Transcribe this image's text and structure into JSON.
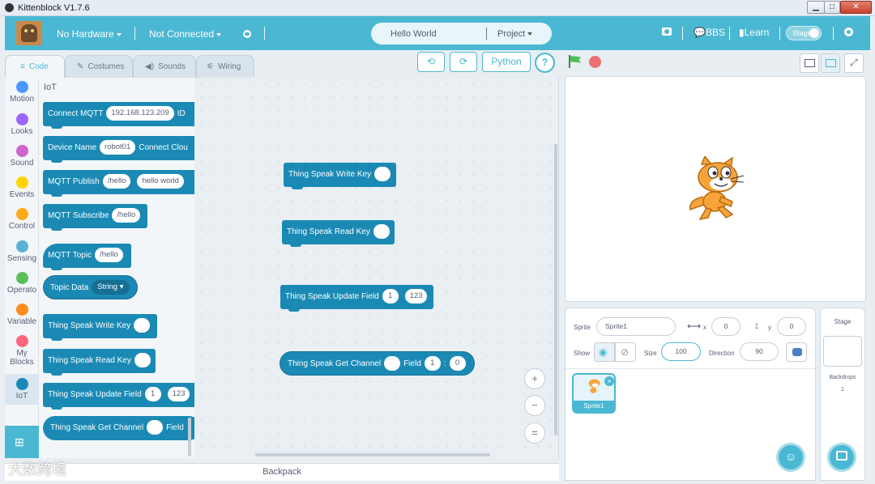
{
  "window": {
    "title": "Kittenblock V1.7.6",
    "controls": [
      "▁",
      "□",
      "✕"
    ]
  },
  "menubar": {
    "hardware": "No Hardware",
    "connection": "Not Connected",
    "project_name": "Hello World",
    "project_menu": "Project",
    "bbs": "BBS",
    "learn": "Learn",
    "stage_toggle": "Stage"
  },
  "tabs": [
    {
      "label": "Code",
      "active": true
    },
    {
      "label": "Costumes",
      "active": false
    },
    {
      "label": "Sounds",
      "active": false
    },
    {
      "label": "Wiring",
      "active": false
    }
  ],
  "toolbar": {
    "python_label": "Python",
    "help_label": "?"
  },
  "categories": [
    {
      "label": "Motion",
      "color": "#4c97ff"
    },
    {
      "label": "Looks",
      "color": "#9966ff"
    },
    {
      "label": "Sound",
      "color": "#cf63cf"
    },
    {
      "label": "Events",
      "color": "#ffd500"
    },
    {
      "label": "Control",
      "color": "#ffab19"
    },
    {
      "label": "Sensing",
      "color": "#5cb1d6"
    },
    {
      "label": "Operato",
      "color": "#59c059"
    },
    {
      "label": "Variable",
      "color": "#ff8c1a"
    },
    {
      "label": "My Blocks",
      "color": "#ff6680"
    },
    {
      "label": "IoT",
      "color": "#1a8ab5"
    }
  ],
  "palette": {
    "heading": "IoT",
    "connect_mqtt": {
      "label": "Connect MQTT",
      "ip": "192.168.123.209",
      "id_label": "ID"
    },
    "device_name": {
      "label": "Device Name",
      "value": "robot01",
      "suffix": "Connect Clou"
    },
    "mqtt_publish": {
      "label": "MQTT Publish",
      "topic": "/hello",
      "message": "hello world"
    },
    "mqtt_subscribe": {
      "label": "MQTT Subscribe",
      "topic": "/hello"
    },
    "mqtt_topic": {
      "label": "MQTT Topic",
      "topic": "/hello"
    },
    "topic_data": {
      "label": "Topic Data",
      "type": "String"
    },
    "ts_write_key": {
      "label": "Thing Speak Write Key"
    },
    "ts_read_key": {
      "label": "Thing Speak Read Key"
    },
    "ts_update_field": {
      "label": "Thing Speak Update Field",
      "field": "1",
      "value": "123"
    },
    "ts_get_channel": {
      "label": "Thing Speak Get Channel",
      "field_label": "Field"
    }
  },
  "workspace": {
    "ts_write_key": {
      "label": "Thing Speak Write Key"
    },
    "ts_read_key": {
      "label": "Thing Speak Read Key"
    },
    "ts_update_field": {
      "label": "Thing Speak Update Field",
      "field": "1",
      "value": "123"
    },
    "ts_get_channel": {
      "label": "Thing Speak Get Channel",
      "field_label": "Field",
      "field": "1",
      "colon": ":",
      "index": "0"
    },
    "zoom_in": "+",
    "zoom_out": "−",
    "zoom_reset": "="
  },
  "backpack": {
    "label": "Backpack"
  },
  "sprite_info": {
    "sprite_label": "Sprite",
    "sprite_name": "Sprite1",
    "x_label": "x",
    "x": "0",
    "y_label": "y",
    "y": "0",
    "show_label": "Show",
    "size_label": "Size",
    "size": "100",
    "direction_label": "Direction",
    "direction": "90"
  },
  "sprites": [
    {
      "name": "Sprite1",
      "selected": true
    }
  ],
  "stage_panel": {
    "title": "Stage",
    "backdrops_label": "Backdrops",
    "backdrops_count": "1"
  },
  "watermark": "大数跨境"
}
